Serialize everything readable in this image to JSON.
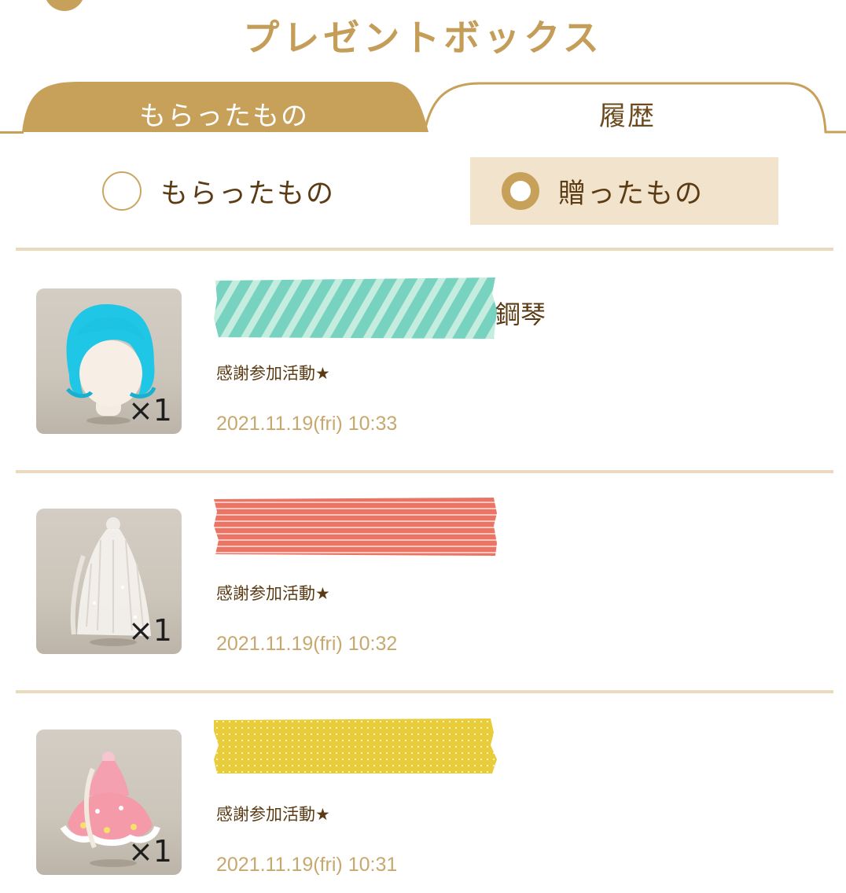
{
  "header": {
    "title": "プレゼントボックス"
  },
  "tabs": [
    {
      "label": "もらったもの",
      "active": true
    },
    {
      "label": "履歴",
      "active": false
    }
  ],
  "filter": {
    "options": [
      {
        "label": "もらったもの",
        "selected": false
      },
      {
        "label": "贈ったもの",
        "selected": true
      }
    ]
  },
  "entries": [
    {
      "name_suffix": "鋼琴",
      "quantity": "×1",
      "note": "感謝参加活動★",
      "timestamp": "2021.11.19(fri) 10:33",
      "item_icon": "blue-hair-icon",
      "name_mask_color": "#77d2bf"
    },
    {
      "name_suffix": "",
      "quantity": "×1",
      "note": "感謝参加活動★",
      "timestamp": "2021.11.19(fri) 10:32",
      "item_icon": "white-veil-icon",
      "name_mask_color": "#e97566"
    },
    {
      "name_suffix": "",
      "quantity": "×1",
      "note": "感謝参加活動★",
      "timestamp": "2021.11.19(fri) 10:31",
      "item_icon": "pink-dress-icon",
      "name_mask_color": "#e9cc3a"
    }
  ],
  "colors": {
    "accent": "#c7a05a",
    "selected_bg": "#f1e3cc",
    "timestamp": "#c7a86e",
    "text": "#5a3b14"
  }
}
